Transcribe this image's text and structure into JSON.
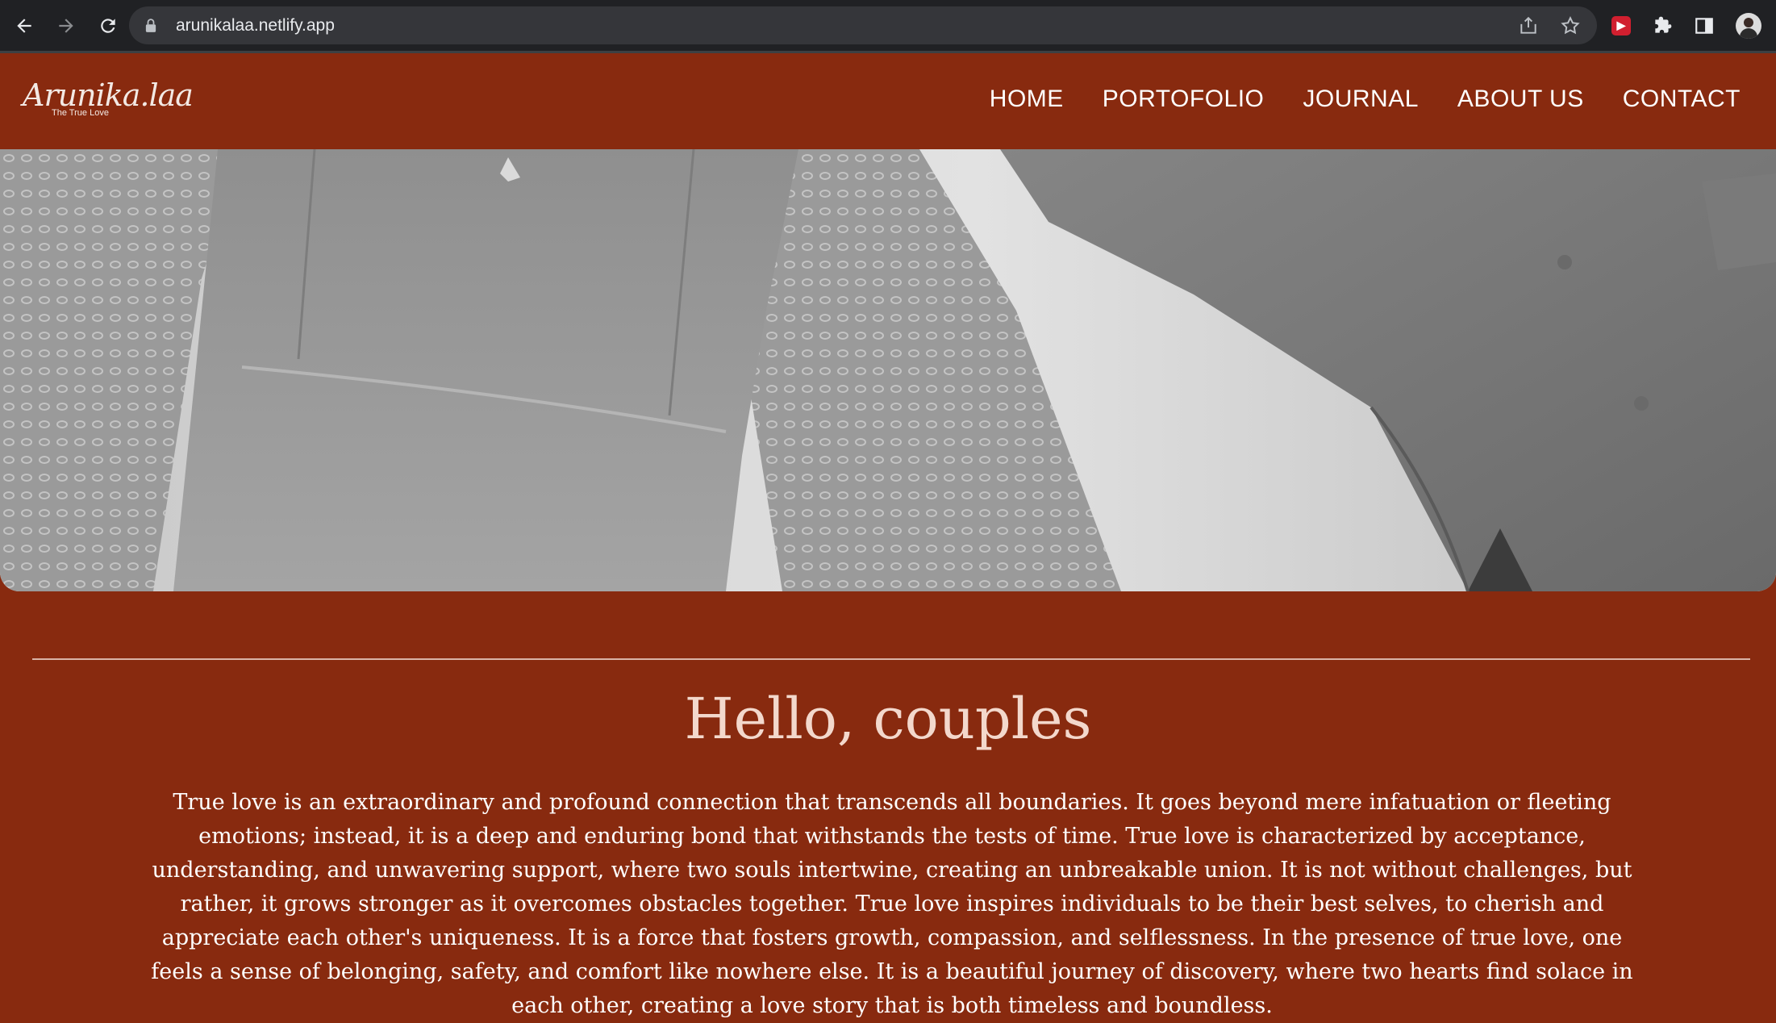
{
  "browser": {
    "url": "arunikalaa.netlify.app",
    "icons": [
      "back-icon",
      "forward-icon",
      "reload-icon",
      "lock-icon",
      "share-icon",
      "star-icon",
      "extension-red-icon",
      "puzzle-icon",
      "side-panel-icon",
      "profile-avatar"
    ]
  },
  "site": {
    "logo_main": "Arunika.laa",
    "logo_sub": "The True Love",
    "nav": [
      "HOME",
      "PORTOFOLIO",
      "JOURNAL",
      "ABOUT US",
      "CONTACT"
    ]
  },
  "content": {
    "headline": "Hello, couples",
    "paragraph": "True love is an extraordinary and profound connection that transcends all boundaries. It goes beyond mere infatuation or fleeting emotions; instead, it is a deep and enduring bond that withstands the tests of time. True love is characterized by acceptance, understanding, and unwavering support, where two souls intertwine, creating an unbreakable union. It is not without challenges, but rather, it grows stronger as it overcomes obstacles together. True love inspires individuals to be their best selves, to cherish and appreciate each other's uniqueness. It is a force that fosters growth, compassion, and selflessness. In the presence of true love, one feels a sense of belonging, safety, and comfort like nowhere else. It is a beautiful journey of discovery, where two hearts find solace in each other, creating a love story that is both timeless and boundless."
  },
  "colors": {
    "brand_rust": "#882a0f",
    "headline": "#f3d8cc",
    "chrome_dark": "#202124"
  }
}
